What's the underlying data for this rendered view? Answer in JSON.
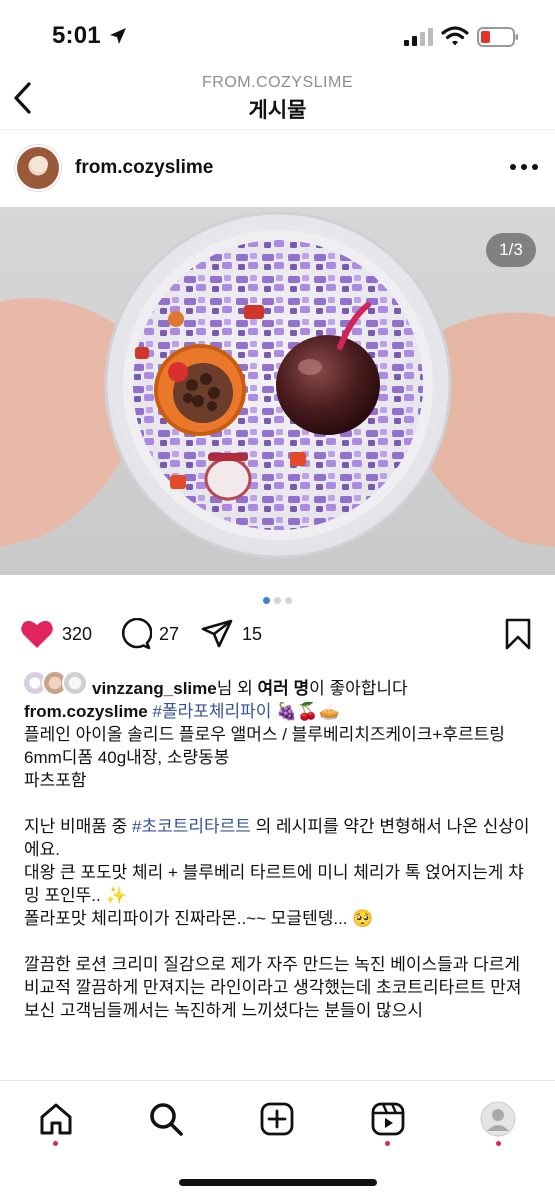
{
  "status_bar": {
    "time": "5:01"
  },
  "header": {
    "subtitle": "FROM.COZYSLIME",
    "title": "게시물"
  },
  "post": {
    "username": "from.cozyslime",
    "media_counter": "1/3",
    "slide_count": 3,
    "active_slide": 1
  },
  "actions": {
    "likes": "320",
    "comments": "27",
    "shares": "15"
  },
  "likes_line": {
    "user": "vinzzang_slime",
    "mid": "님 외 ",
    "others": "여러 명",
    "tail": "이 좋아합니다"
  },
  "caption": {
    "username": "from.cozyslime",
    "hashtag1": "#폴라포체리파이",
    "emoji1": "🍇🍒🥧",
    "line2": "플레인 아이올 솔리드 플로우 앨머스 / 블루베리치즈케이크+후르트링",
    "line3": "6mm디폼 40g내장, 소량동봉",
    "line4": "파츠포함",
    "line5_pre": "지난 비매품 중 ",
    "hashtag2": "#초코트리타르트",
    "line5_post": " 의 레시피를 약간 변형해서 나온 신상이에요.",
    "line6": "대왕 큰 포도맛 체리 + 블루베리 타르트에 미니 체리가 톡 얹어지는게 챠밍 포인뚜..",
    "emoji2": "✨",
    "line7": "폴라포맛 체리파이가 진짜라몬..~~ 모글텐뎅...",
    "emoji3": "🥺",
    "line8": "깔끔한 로션 크리미 질감으로 제가 자주 만드는 녹진 베이스들과 다르게",
    "line9": "비교적 깔끔하게 만져지는 라인이라고 생각했는데 초코트리타르트 만져보신 고객님들께서는 녹진하게 느끼셨다는 분들이 많으시"
  },
  "tabs": [
    "home",
    "search",
    "create",
    "reels",
    "profile"
  ],
  "colors": {
    "like": "#e0245e",
    "hashtag": "#35529a",
    "active_dot": "#3b82d6"
  }
}
